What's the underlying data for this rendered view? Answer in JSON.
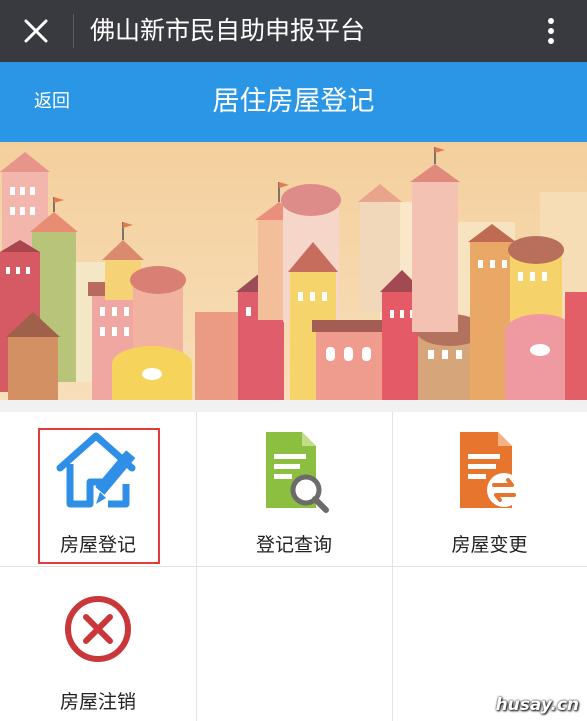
{
  "wechat_bar": {
    "title": "佛山新市民自助申报平台",
    "close_icon": "close-icon",
    "more_icon": "more-vertical-icon"
  },
  "header": {
    "back_label": "返回",
    "title": "居住房屋登记",
    "background": "#2b96e6"
  },
  "menu": {
    "items": [
      {
        "label": "房屋登记",
        "icon": "house-pencil-icon",
        "color": "#2f8fe6",
        "selected": true
      },
      {
        "label": "登记查询",
        "icon": "document-search-icon",
        "color": "#8cbf3f"
      },
      {
        "label": "房屋变更",
        "icon": "document-swap-icon",
        "color": "#e8752e"
      },
      {
        "label": "房屋注销",
        "icon": "cancel-circle-icon",
        "color": "#c9373a"
      }
    ]
  },
  "watermark": "husay.cn"
}
